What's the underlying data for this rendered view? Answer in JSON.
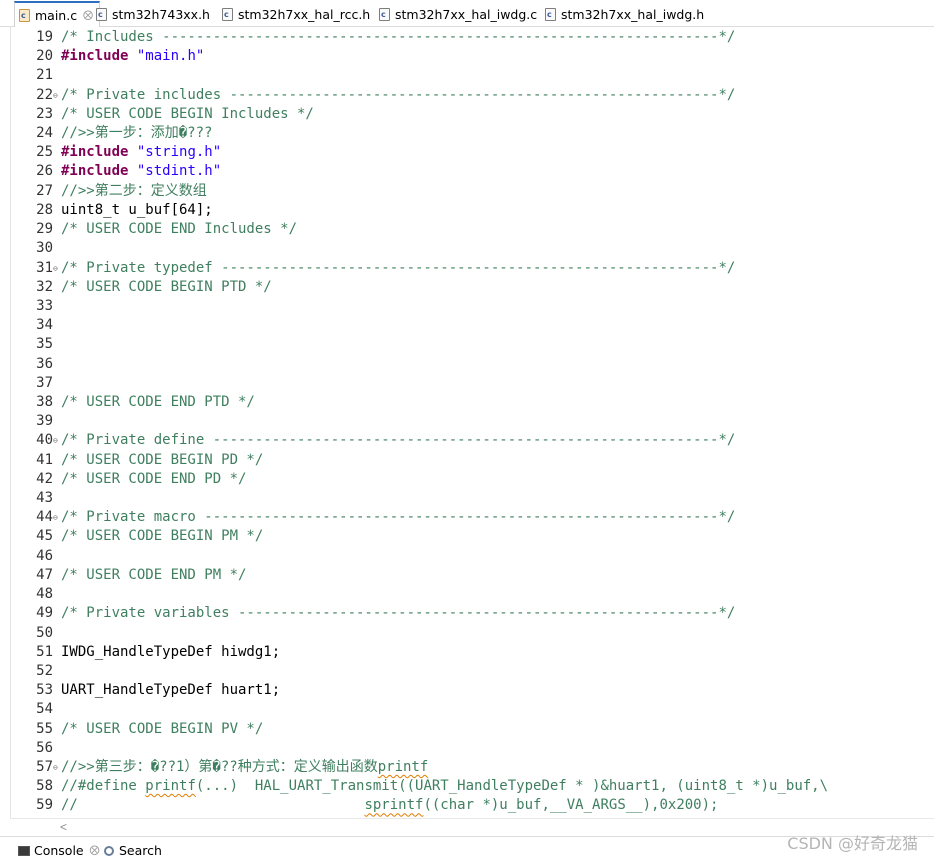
{
  "tabs": [
    {
      "label": "main.c",
      "close": "⨂",
      "icon_letter": "c"
    },
    {
      "label": "stm32h743xx.h",
      "icon_letter": "c"
    },
    {
      "label": "stm32h7xx_hal_rcc.h",
      "icon_letter": "c"
    },
    {
      "label": "stm32h7xx_hal_iwdg.c",
      "icon_letter": "c"
    },
    {
      "label": "stm32h7xx_hal_iwdg.h",
      "icon_letter": "c"
    }
  ],
  "colors": {
    "comment": "#3f7f5f",
    "keyword": "#7f0055",
    "string": "#2a00ff",
    "active_tab_accent": "#2d6fbf"
  },
  "editor": {
    "lines": [
      {
        "n": "19",
        "segs": [
          {
            "t": "/* Includes ------------------------------------------------------------------*/",
            "c": "cmt"
          }
        ]
      },
      {
        "n": "20",
        "segs": [
          {
            "t": "#include",
            "c": "kw"
          },
          {
            "t": " ",
            "c": ""
          },
          {
            "t": "\"main.h\"",
            "c": "str"
          }
        ]
      },
      {
        "n": "21",
        "segs": []
      },
      {
        "n": "22",
        "fold": "⊖",
        "segs": [
          {
            "t": "/* Private includes ----------------------------------------------------------*/",
            "c": "cmt"
          }
        ]
      },
      {
        "n": "23",
        "segs": [
          {
            "t": "/* USER CODE BEGIN Includes */",
            "c": "cmt"
          }
        ]
      },
      {
        "n": "24",
        "segs": [
          {
            "t": "//>>第一步：添加�???",
            "c": "cmt"
          }
        ]
      },
      {
        "n": "25",
        "segs": [
          {
            "t": "#include",
            "c": "kw"
          },
          {
            "t": " ",
            "c": ""
          },
          {
            "t": "\"string.h\"",
            "c": "str"
          }
        ]
      },
      {
        "n": "26",
        "segs": [
          {
            "t": "#include",
            "c": "kw"
          },
          {
            "t": " ",
            "c": ""
          },
          {
            "t": "\"stdint.h\"",
            "c": "str"
          }
        ]
      },
      {
        "n": "27",
        "segs": [
          {
            "t": "//>>第二步：定义数组",
            "c": "cmt"
          }
        ]
      },
      {
        "n": "28",
        "segs": [
          {
            "t": "uint8_t u_buf[64];",
            "c": ""
          }
        ]
      },
      {
        "n": "29",
        "segs": [
          {
            "t": "/* USER CODE END Includes */",
            "c": "cmt"
          }
        ]
      },
      {
        "n": "30",
        "segs": []
      },
      {
        "n": "31",
        "fold": "⊖",
        "segs": [
          {
            "t": "/* Private typedef -----------------------------------------------------------*/",
            "c": "cmt"
          }
        ]
      },
      {
        "n": "32",
        "segs": [
          {
            "t": "/* USER CODE BEGIN PTD */",
            "c": "cmt"
          }
        ]
      },
      {
        "n": "33",
        "segs": []
      },
      {
        "n": "34",
        "segs": []
      },
      {
        "n": "35",
        "segs": []
      },
      {
        "n": "36",
        "segs": []
      },
      {
        "n": "37",
        "segs": []
      },
      {
        "n": "38",
        "segs": [
          {
            "t": "/* USER CODE END PTD */",
            "c": "cmt"
          }
        ]
      },
      {
        "n": "39",
        "segs": []
      },
      {
        "n": "40",
        "fold": "⊖",
        "segs": [
          {
            "t": "/* Private define ------------------------------------------------------------*/",
            "c": "cmt"
          }
        ]
      },
      {
        "n": "41",
        "segs": [
          {
            "t": "/* USER CODE BEGIN PD */",
            "c": "cmt"
          }
        ]
      },
      {
        "n": "42",
        "segs": [
          {
            "t": "/* USER CODE END PD */",
            "c": "cmt"
          }
        ]
      },
      {
        "n": "43",
        "segs": []
      },
      {
        "n": "44",
        "fold": "⊖",
        "segs": [
          {
            "t": "/* Private macro -------------------------------------------------------------*/",
            "c": "cmt"
          }
        ]
      },
      {
        "n": "45",
        "segs": [
          {
            "t": "/* USER CODE BEGIN PM */",
            "c": "cmt"
          }
        ]
      },
      {
        "n": "46",
        "segs": []
      },
      {
        "n": "47",
        "segs": [
          {
            "t": "/* USER CODE END PM */",
            "c": "cmt"
          }
        ]
      },
      {
        "n": "48",
        "segs": []
      },
      {
        "n": "49",
        "segs": [
          {
            "t": "/* Private variables ---------------------------------------------------------*/",
            "c": "cmt"
          }
        ]
      },
      {
        "n": "50",
        "segs": []
      },
      {
        "n": "51",
        "segs": [
          {
            "t": "IWDG_HandleTypeDef hiwdg1;",
            "c": ""
          }
        ]
      },
      {
        "n": "52",
        "segs": []
      },
      {
        "n": "53",
        "segs": [
          {
            "t": "UART_HandleTypeDef huart1;",
            "c": ""
          }
        ]
      },
      {
        "n": "54",
        "segs": []
      },
      {
        "n": "55",
        "segs": [
          {
            "t": "/* USER CODE BEGIN PV */",
            "c": "cmt"
          }
        ]
      },
      {
        "n": "56",
        "segs": []
      },
      {
        "n": "57",
        "fold": "⊖",
        "segs": [
          {
            "t": "//>>第三步：�??1）第�??种方式：定义输出函数",
            "c": "cmt"
          },
          {
            "t": "printf",
            "c": "cmt squig"
          }
        ]
      },
      {
        "n": "58",
        "segs": [
          {
            "t": "//#define ",
            "c": "cmt"
          },
          {
            "t": "printf",
            "c": "cmt squig"
          },
          {
            "t": "(...)  HAL_UART_Transmit((UART_HandleTypeDef * )&huart1, (uint8_t *)u_buf,\\",
            "c": "cmt"
          }
        ]
      },
      {
        "n": "59",
        "segs": [
          {
            "t": "//                                  ",
            "c": "cmt"
          },
          {
            "t": "sprintf",
            "c": "cmt squig"
          },
          {
            "t": "((char *)u_buf,__VA_ARGS__),0x200);",
            "c": "cmt"
          }
        ]
      }
    ]
  },
  "hscroll": {
    "left_arrow": "<"
  },
  "bottom_tabs": [
    {
      "label": "Console",
      "close": "⨂"
    },
    {
      "label": "Search"
    }
  ],
  "watermark": "CSDN @好奇龙猫"
}
